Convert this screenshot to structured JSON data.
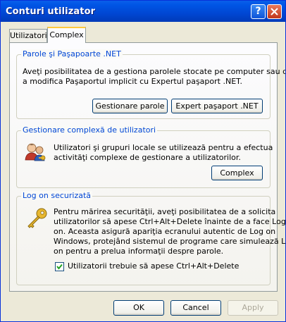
{
  "window": {
    "title": "Conturi utilizator",
    "help_glyph": "?",
    "close_glyph": "✕"
  },
  "tabs": [
    {
      "label": "Utilizatori",
      "active": false
    },
    {
      "label": "Complex",
      "active": true
    }
  ],
  "sections": {
    "passwords": {
      "title": "Parole şi Paşapoarte .NET",
      "description_line1": "Aveţi posibilitatea de a gestiona parolele stocate pe computer sau de",
      "description_line2": "a modifica Paşaportul implicit cu Expertul paşaport .NET.",
      "manage_button": "Gestionare parole",
      "wizard_button": "Expert paşaport .NET"
    },
    "advanced_users": {
      "title": "Gestionare complexă de utilizatori",
      "description_line1": "Utilizatori şi grupuri locale se utilizează pentru a efectua",
      "description_line2": "activităţi complexe de gestionare a utilizatorilor.",
      "button": "Complex"
    },
    "secure_logon": {
      "title": "Log on securizată",
      "line1": "Pentru mărirea securităţii, aveţi posibilitatea de a solicita",
      "line2": "utilizatorilor să apese Ctrl+Alt+Delete înainte de a face Log",
      "line3": "on. Aceasta asigură apariţia ecranului autentic de Log on",
      "line4": "Windows, protejând sistemul de programe care simulează Log",
      "line5": "on pentru a prelua informaţii despre parole.",
      "checkbox_label": "Utilizatorii trebuie să apese Ctrl+Alt+Delete",
      "checkbox_checked": true
    }
  },
  "footer": {
    "ok": "OK",
    "cancel": "Cancel",
    "apply": "Apply"
  },
  "icons": {
    "users": "users-icon",
    "key": "key-icon"
  },
  "colors": {
    "titlebar": "#0054E3",
    "dialog_bg": "#ECE9D8",
    "group_title": "#0046D5",
    "tab_highlight": "#FFC83C"
  }
}
